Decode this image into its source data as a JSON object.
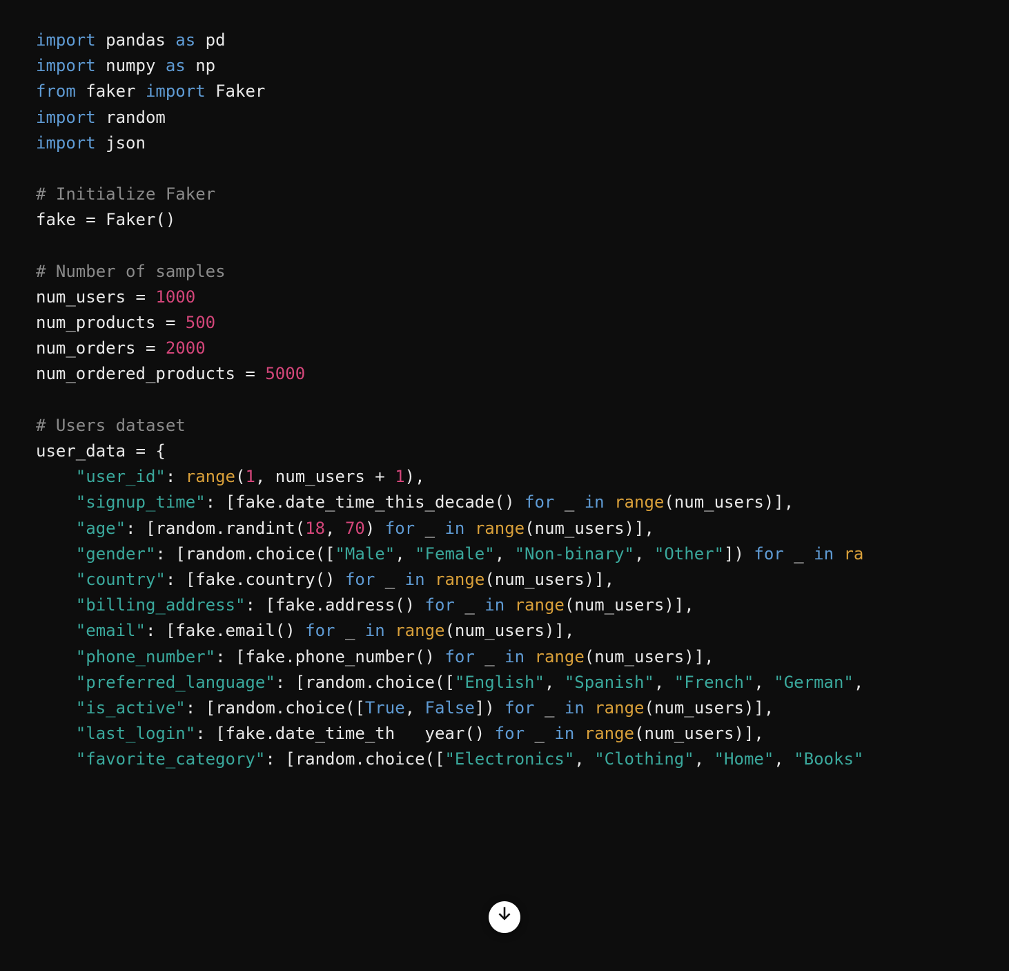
{
  "code": {
    "tokens": [
      [
        [
          "keyword",
          "import"
        ],
        [
          "default",
          " pandas "
        ],
        [
          "keyword",
          "as"
        ],
        [
          "default",
          " pd"
        ]
      ],
      [
        [
          "keyword",
          "import"
        ],
        [
          "default",
          " numpy "
        ],
        [
          "keyword",
          "as"
        ],
        [
          "default",
          " np"
        ]
      ],
      [
        [
          "keyword",
          "from"
        ],
        [
          "default",
          " faker "
        ],
        [
          "keyword",
          "import"
        ],
        [
          "default",
          " Faker"
        ]
      ],
      [
        [
          "keyword",
          "import"
        ],
        [
          "default",
          " random"
        ]
      ],
      [
        [
          "keyword",
          "import"
        ],
        [
          "default",
          " json"
        ]
      ],
      [],
      [
        [
          "comment",
          "# Initialize Faker"
        ]
      ],
      [
        [
          "default",
          "fake = Faker()"
        ]
      ],
      [],
      [
        [
          "comment",
          "# Number of samples"
        ]
      ],
      [
        [
          "default",
          "num_users = "
        ],
        [
          "number",
          "1000"
        ]
      ],
      [
        [
          "default",
          "num_products = "
        ],
        [
          "number",
          "500"
        ]
      ],
      [
        [
          "default",
          "num_orders = "
        ],
        [
          "number",
          "2000"
        ]
      ],
      [
        [
          "default",
          "num_ordered_products = "
        ],
        [
          "number",
          "5000"
        ]
      ],
      [],
      [
        [
          "comment",
          "# Users dataset"
        ]
      ],
      [
        [
          "default",
          "user_data = {"
        ]
      ],
      [
        [
          "default",
          "    "
        ],
        [
          "string",
          "\"user_id\""
        ],
        [
          "default",
          ": "
        ],
        [
          "builtin",
          "range"
        ],
        [
          "default",
          "("
        ],
        [
          "number",
          "1"
        ],
        [
          "default",
          ", num_users + "
        ],
        [
          "number",
          "1"
        ],
        [
          "default",
          "),"
        ]
      ],
      [
        [
          "default",
          "    "
        ],
        [
          "string",
          "\"signup_time\""
        ],
        [
          "default",
          ": [fake.date_time_this_decade() "
        ],
        [
          "keyword",
          "for"
        ],
        [
          "default",
          " _ "
        ],
        [
          "keyword",
          "in"
        ],
        [
          "default",
          " "
        ],
        [
          "builtin",
          "range"
        ],
        [
          "default",
          "(num_users)],"
        ]
      ],
      [
        [
          "default",
          "    "
        ],
        [
          "string",
          "\"age\""
        ],
        [
          "default",
          ": [random.randint("
        ],
        [
          "number",
          "18"
        ],
        [
          "default",
          ", "
        ],
        [
          "number",
          "70"
        ],
        [
          "default",
          ") "
        ],
        [
          "keyword",
          "for"
        ],
        [
          "default",
          " _ "
        ],
        [
          "keyword",
          "in"
        ],
        [
          "default",
          " "
        ],
        [
          "builtin",
          "range"
        ],
        [
          "default",
          "(num_users)],"
        ]
      ],
      [
        [
          "default",
          "    "
        ],
        [
          "string",
          "\"gender\""
        ],
        [
          "default",
          ": [random.choice(["
        ],
        [
          "string",
          "\"Male\""
        ],
        [
          "default",
          ", "
        ],
        [
          "string",
          "\"Female\""
        ],
        [
          "default",
          ", "
        ],
        [
          "string",
          "\"Non-binary\""
        ],
        [
          "default",
          ", "
        ],
        [
          "string",
          "\"Other\""
        ],
        [
          "default",
          "]) "
        ],
        [
          "keyword",
          "for"
        ],
        [
          "default",
          " _ "
        ],
        [
          "keyword",
          "in"
        ],
        [
          "default",
          " "
        ],
        [
          "builtin",
          "ra"
        ]
      ],
      [
        [
          "default",
          "    "
        ],
        [
          "string",
          "\"country\""
        ],
        [
          "default",
          ": [fake.country() "
        ],
        [
          "keyword",
          "for"
        ],
        [
          "default",
          " _ "
        ],
        [
          "keyword",
          "in"
        ],
        [
          "default",
          " "
        ],
        [
          "builtin",
          "range"
        ],
        [
          "default",
          "(num_users)],"
        ]
      ],
      [
        [
          "default",
          "    "
        ],
        [
          "string",
          "\"billing_address\""
        ],
        [
          "default",
          ": [fake.address() "
        ],
        [
          "keyword",
          "for"
        ],
        [
          "default",
          " _ "
        ],
        [
          "keyword",
          "in"
        ],
        [
          "default",
          " "
        ],
        [
          "builtin",
          "range"
        ],
        [
          "default",
          "(num_users)],"
        ]
      ],
      [
        [
          "default",
          "    "
        ],
        [
          "string",
          "\"email\""
        ],
        [
          "default",
          ": [fake.email() "
        ],
        [
          "keyword",
          "for"
        ],
        [
          "default",
          " _ "
        ],
        [
          "keyword",
          "in"
        ],
        [
          "default",
          " "
        ],
        [
          "builtin",
          "range"
        ],
        [
          "default",
          "(num_users)],"
        ]
      ],
      [
        [
          "default",
          "    "
        ],
        [
          "string",
          "\"phone_number\""
        ],
        [
          "default",
          ": [fake.phone_number() "
        ],
        [
          "keyword",
          "for"
        ],
        [
          "default",
          " _ "
        ],
        [
          "keyword",
          "in"
        ],
        [
          "default",
          " "
        ],
        [
          "builtin",
          "range"
        ],
        [
          "default",
          "(num_users)],"
        ]
      ],
      [
        [
          "default",
          "    "
        ],
        [
          "string",
          "\"preferred_language\""
        ],
        [
          "default",
          ": [random.choice(["
        ],
        [
          "string",
          "\"English\""
        ],
        [
          "default",
          ", "
        ],
        [
          "string",
          "\"Spanish\""
        ],
        [
          "default",
          ", "
        ],
        [
          "string",
          "\"French\""
        ],
        [
          "default",
          ", "
        ],
        [
          "string",
          "\"German\""
        ],
        [
          "default",
          ","
        ]
      ],
      [
        [
          "default",
          "    "
        ],
        [
          "string",
          "\"is_active\""
        ],
        [
          "default",
          ": [random.choice(["
        ],
        [
          "bool",
          "True"
        ],
        [
          "default",
          ", "
        ],
        [
          "bool",
          "False"
        ],
        [
          "default",
          "]) "
        ],
        [
          "keyword",
          "for"
        ],
        [
          "default",
          " _ "
        ],
        [
          "keyword",
          "in"
        ],
        [
          "default",
          " "
        ],
        [
          "builtin",
          "range"
        ],
        [
          "default",
          "(num_users)],"
        ]
      ],
      [
        [
          "default",
          "    "
        ],
        [
          "string",
          "\"last_login\""
        ],
        [
          "default",
          ": [fake.date_time_th   year() "
        ],
        [
          "keyword",
          "for"
        ],
        [
          "default",
          " _ "
        ],
        [
          "keyword",
          "in"
        ],
        [
          "default",
          " "
        ],
        [
          "builtin",
          "range"
        ],
        [
          "default",
          "(num_users)],"
        ]
      ],
      [
        [
          "default",
          "    "
        ],
        [
          "string",
          "\"favorite_category\""
        ],
        [
          "default",
          ": [random.choice(["
        ],
        [
          "string",
          "\"Electronics\""
        ],
        [
          "default",
          ", "
        ],
        [
          "string",
          "\"Clothing\""
        ],
        [
          "default",
          ", "
        ],
        [
          "string",
          "\"Home\""
        ],
        [
          "default",
          ", "
        ],
        [
          "string",
          "\"Books\""
        ]
      ]
    ]
  },
  "scroll_button": {
    "icon": "arrow-down-icon"
  }
}
